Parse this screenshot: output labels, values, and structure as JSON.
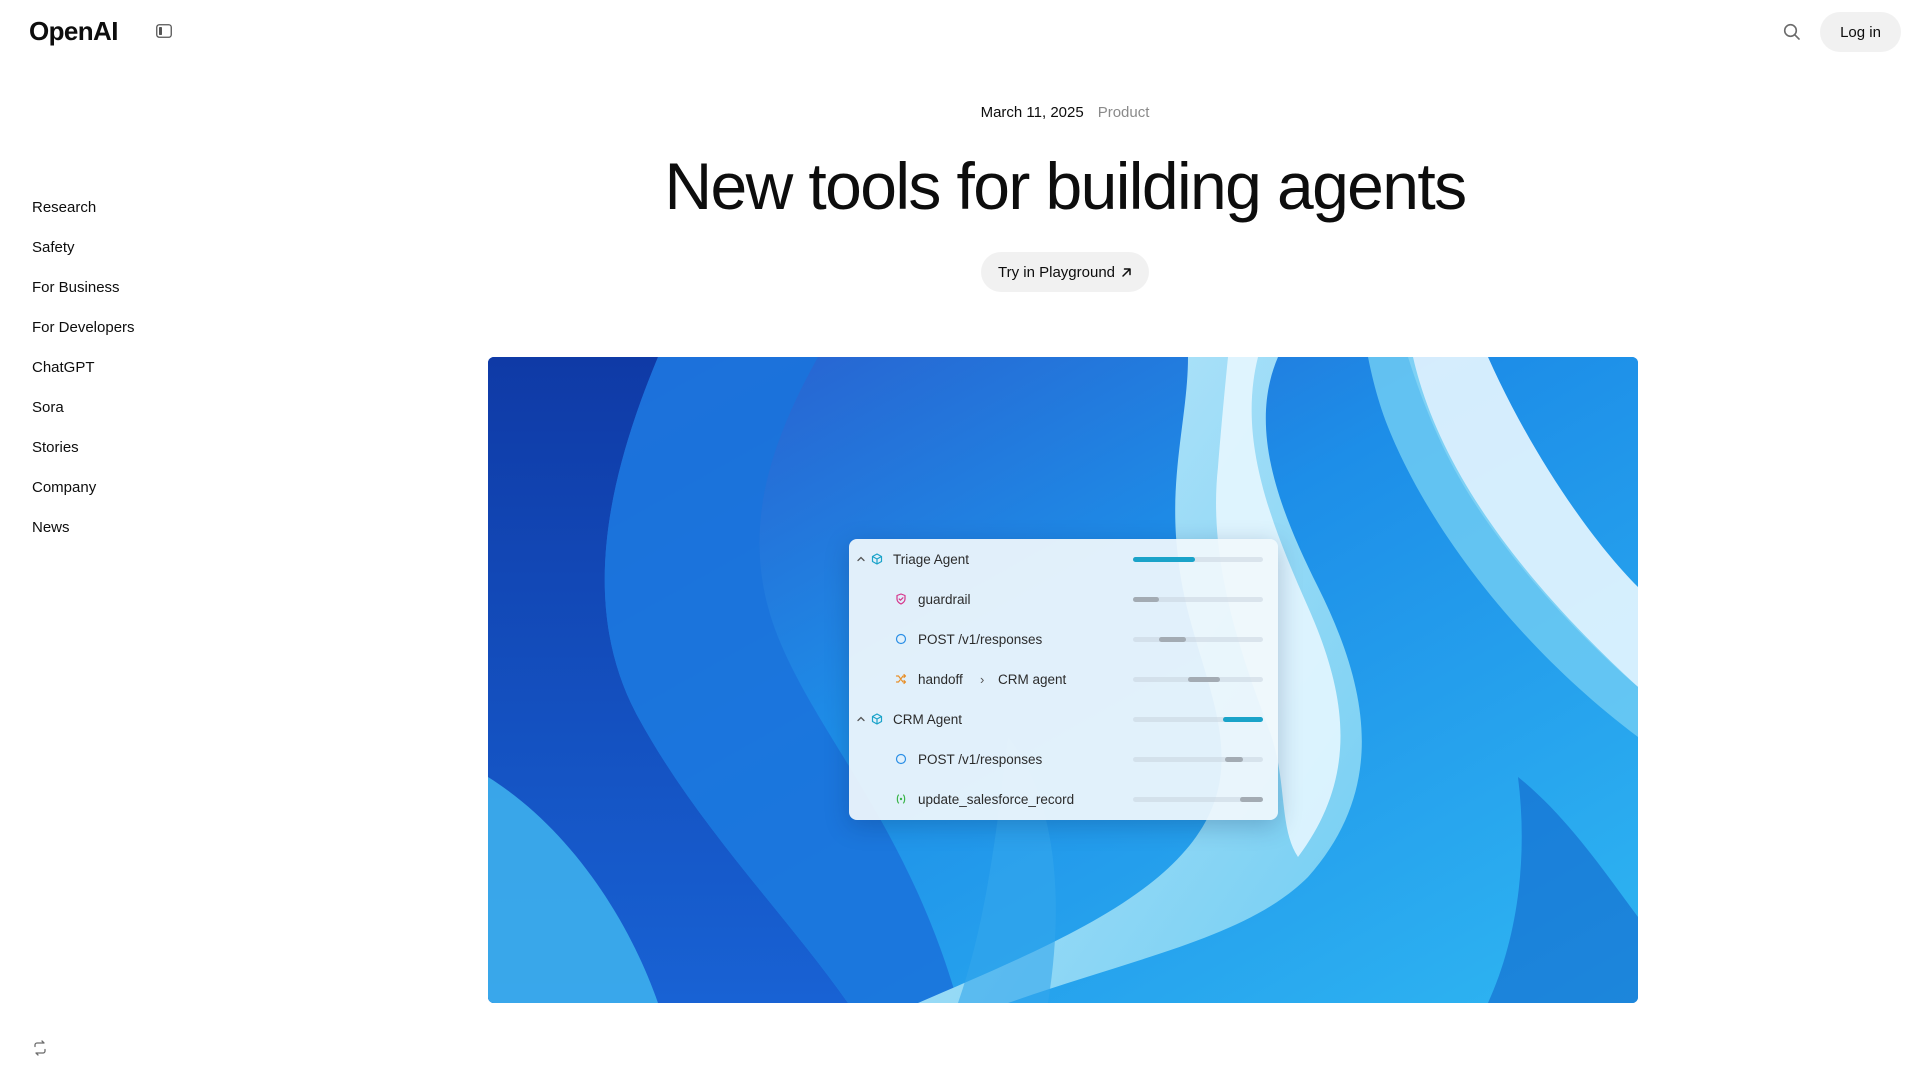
{
  "header": {
    "logo": "OpenAI",
    "login_label": "Log in"
  },
  "sidenav": {
    "items": [
      "Research",
      "Safety",
      "For Business",
      "For Developers",
      "ChatGPT",
      "Sora",
      "Stories",
      "Company",
      "News"
    ]
  },
  "article": {
    "date": "March 11, 2025",
    "category": "Product",
    "title": "New tools for building agents",
    "cta_label": "Try in Playground"
  },
  "trace_panel": {
    "rows": [
      {
        "label": "Triage Agent",
        "kind": "agent",
        "icon": "cube-icon",
        "bar_start": 0.0,
        "bar_end": 0.48,
        "bar_color": "#1aa3c9"
      },
      {
        "label": "guardrail",
        "kind": "guardrail",
        "icon": "shield-check-icon",
        "bar_start": 0.0,
        "bar_end": 0.2,
        "bar_color": "#a3abb3"
      },
      {
        "label": "POST /v1/responses",
        "kind": "response",
        "icon": "circle-icon",
        "bar_start": 0.2,
        "bar_end": 0.41,
        "bar_color": "#a3abb3"
      },
      {
        "label": "handoff",
        "target": "CRM agent",
        "kind": "handoff",
        "icon": "shuffle-icon",
        "bar_start": 0.42,
        "bar_end": 0.67,
        "bar_color": "#a3abb3"
      },
      {
        "label": "CRM Agent",
        "kind": "agent",
        "icon": "cube-icon",
        "bar_start": 0.69,
        "bar_end": 1.0,
        "bar_color": "#1aa3c9"
      },
      {
        "label": "POST /v1/responses",
        "kind": "response",
        "icon": "circle-icon",
        "bar_start": 0.71,
        "bar_end": 0.85,
        "bar_color": "#a3abb3"
      },
      {
        "label": "update_salesforce_record",
        "kind": "function",
        "icon": "function-icon",
        "bar_start": 0.82,
        "bar_end": 1.0,
        "bar_color": "#a3abb3"
      }
    ]
  }
}
